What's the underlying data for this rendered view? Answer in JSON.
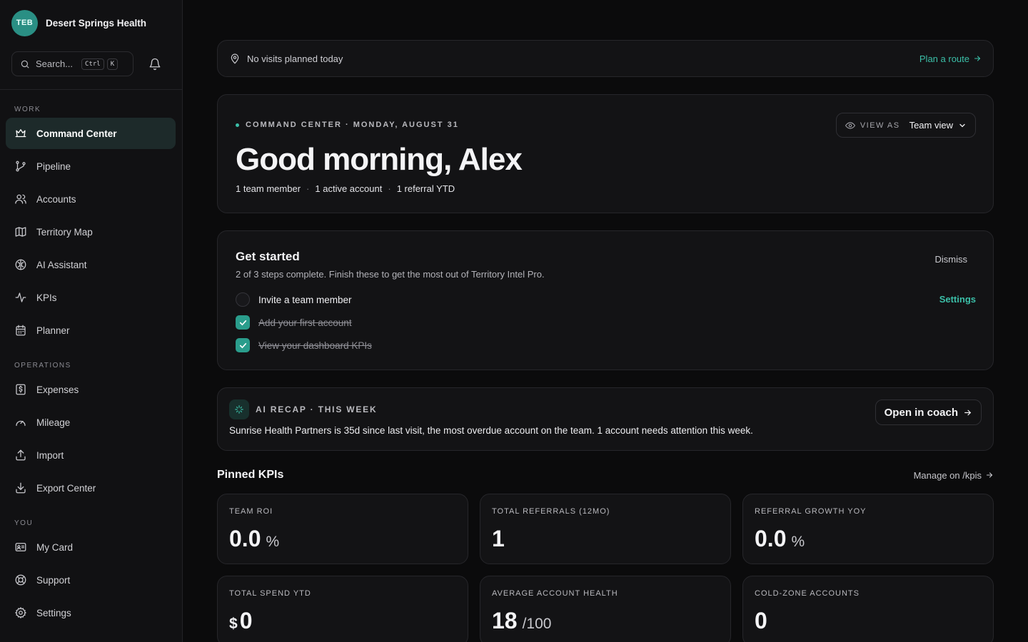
{
  "brand": {
    "logo_text": "TEB",
    "name": "Desert Springs Health"
  },
  "search": {
    "placeholder": "Search...",
    "key1": "Ctrl",
    "key2": "K"
  },
  "sidebar": {
    "sections": [
      {
        "title": "WORK",
        "items": [
          {
            "label": "Command Center",
            "icon": "crown-icon",
            "active": true
          },
          {
            "label": "Pipeline",
            "icon": "git-branch-icon"
          },
          {
            "label": "Accounts",
            "icon": "users-icon"
          },
          {
            "label": "Territory Map",
            "icon": "map-icon"
          },
          {
            "label": "AI Assistant",
            "icon": "brain-icon"
          },
          {
            "label": "KPIs",
            "icon": "activity-icon"
          },
          {
            "label": "Planner",
            "icon": "calendar-icon"
          }
        ]
      },
      {
        "title": "OPERATIONS",
        "items": [
          {
            "label": "Expenses",
            "icon": "receipt-icon"
          },
          {
            "label": "Mileage",
            "icon": "gauge-icon"
          },
          {
            "label": "Import",
            "icon": "upload-icon"
          },
          {
            "label": "Export Center",
            "icon": "download-icon"
          }
        ]
      },
      {
        "title": "YOU",
        "items": [
          {
            "label": "My Card",
            "icon": "id-card-icon"
          },
          {
            "label": "Support",
            "icon": "lifebuoy-icon"
          },
          {
            "label": "Settings",
            "icon": "gear-icon"
          }
        ]
      }
    ]
  },
  "visits": {
    "text": "No visits planned today",
    "action": "Plan a route"
  },
  "hero": {
    "eyebrow": "COMMAND CENTER · MONDAY, AUGUST 31",
    "greeting": "Good morning, Alex",
    "stats": [
      "1 team member",
      "1 active account",
      "1 referral YTD"
    ],
    "separator": "·",
    "view_as_label": "VIEW AS",
    "view_as_value": "Team view"
  },
  "get_started": {
    "title": "Get started",
    "subtitle": "2 of 3 steps complete. Finish these to get the most out of Territory Intel Pro.",
    "dismiss": "Dismiss",
    "settings": "Settings",
    "steps": [
      {
        "label": "Invite a team member",
        "done": false
      },
      {
        "label": "Add your first account",
        "done": true
      },
      {
        "label": "View your dashboard KPIs",
        "done": true
      }
    ]
  },
  "recap": {
    "title": "AI RECAP · THIS WEEK",
    "text": "Sunrise Health Partners is 35d since last visit, the most overdue account on the team. 1 account needs attention this week.",
    "button": "Open in coach"
  },
  "kpis": {
    "title": "Pinned KPIs",
    "manage": "Manage on /kpis",
    "cards": [
      {
        "label": "TEAM ROI",
        "prefix": "",
        "value": "0.0",
        "suffix": "%"
      },
      {
        "label": "TOTAL REFERRALS (12MO)",
        "prefix": "",
        "value": "1",
        "suffix": ""
      },
      {
        "label": "REFERRAL GROWTH YOY",
        "prefix": "",
        "value": "0.0",
        "suffix": "%"
      },
      {
        "label": "TOTAL SPEND YTD",
        "prefix": "$",
        "value": "0",
        "suffix": ""
      },
      {
        "label": "AVERAGE ACCOUNT HEALTH",
        "prefix": "",
        "value": "18",
        "suffix": "/100"
      },
      {
        "label": "COLD-ZONE ACCOUNTS",
        "prefix": "",
        "value": "0",
        "suffix": ""
      }
    ]
  },
  "colors": {
    "accent": "#3bbfa8",
    "background": "#0b0b0c",
    "card": "#131315",
    "active_nav": "#1d2a2a"
  }
}
